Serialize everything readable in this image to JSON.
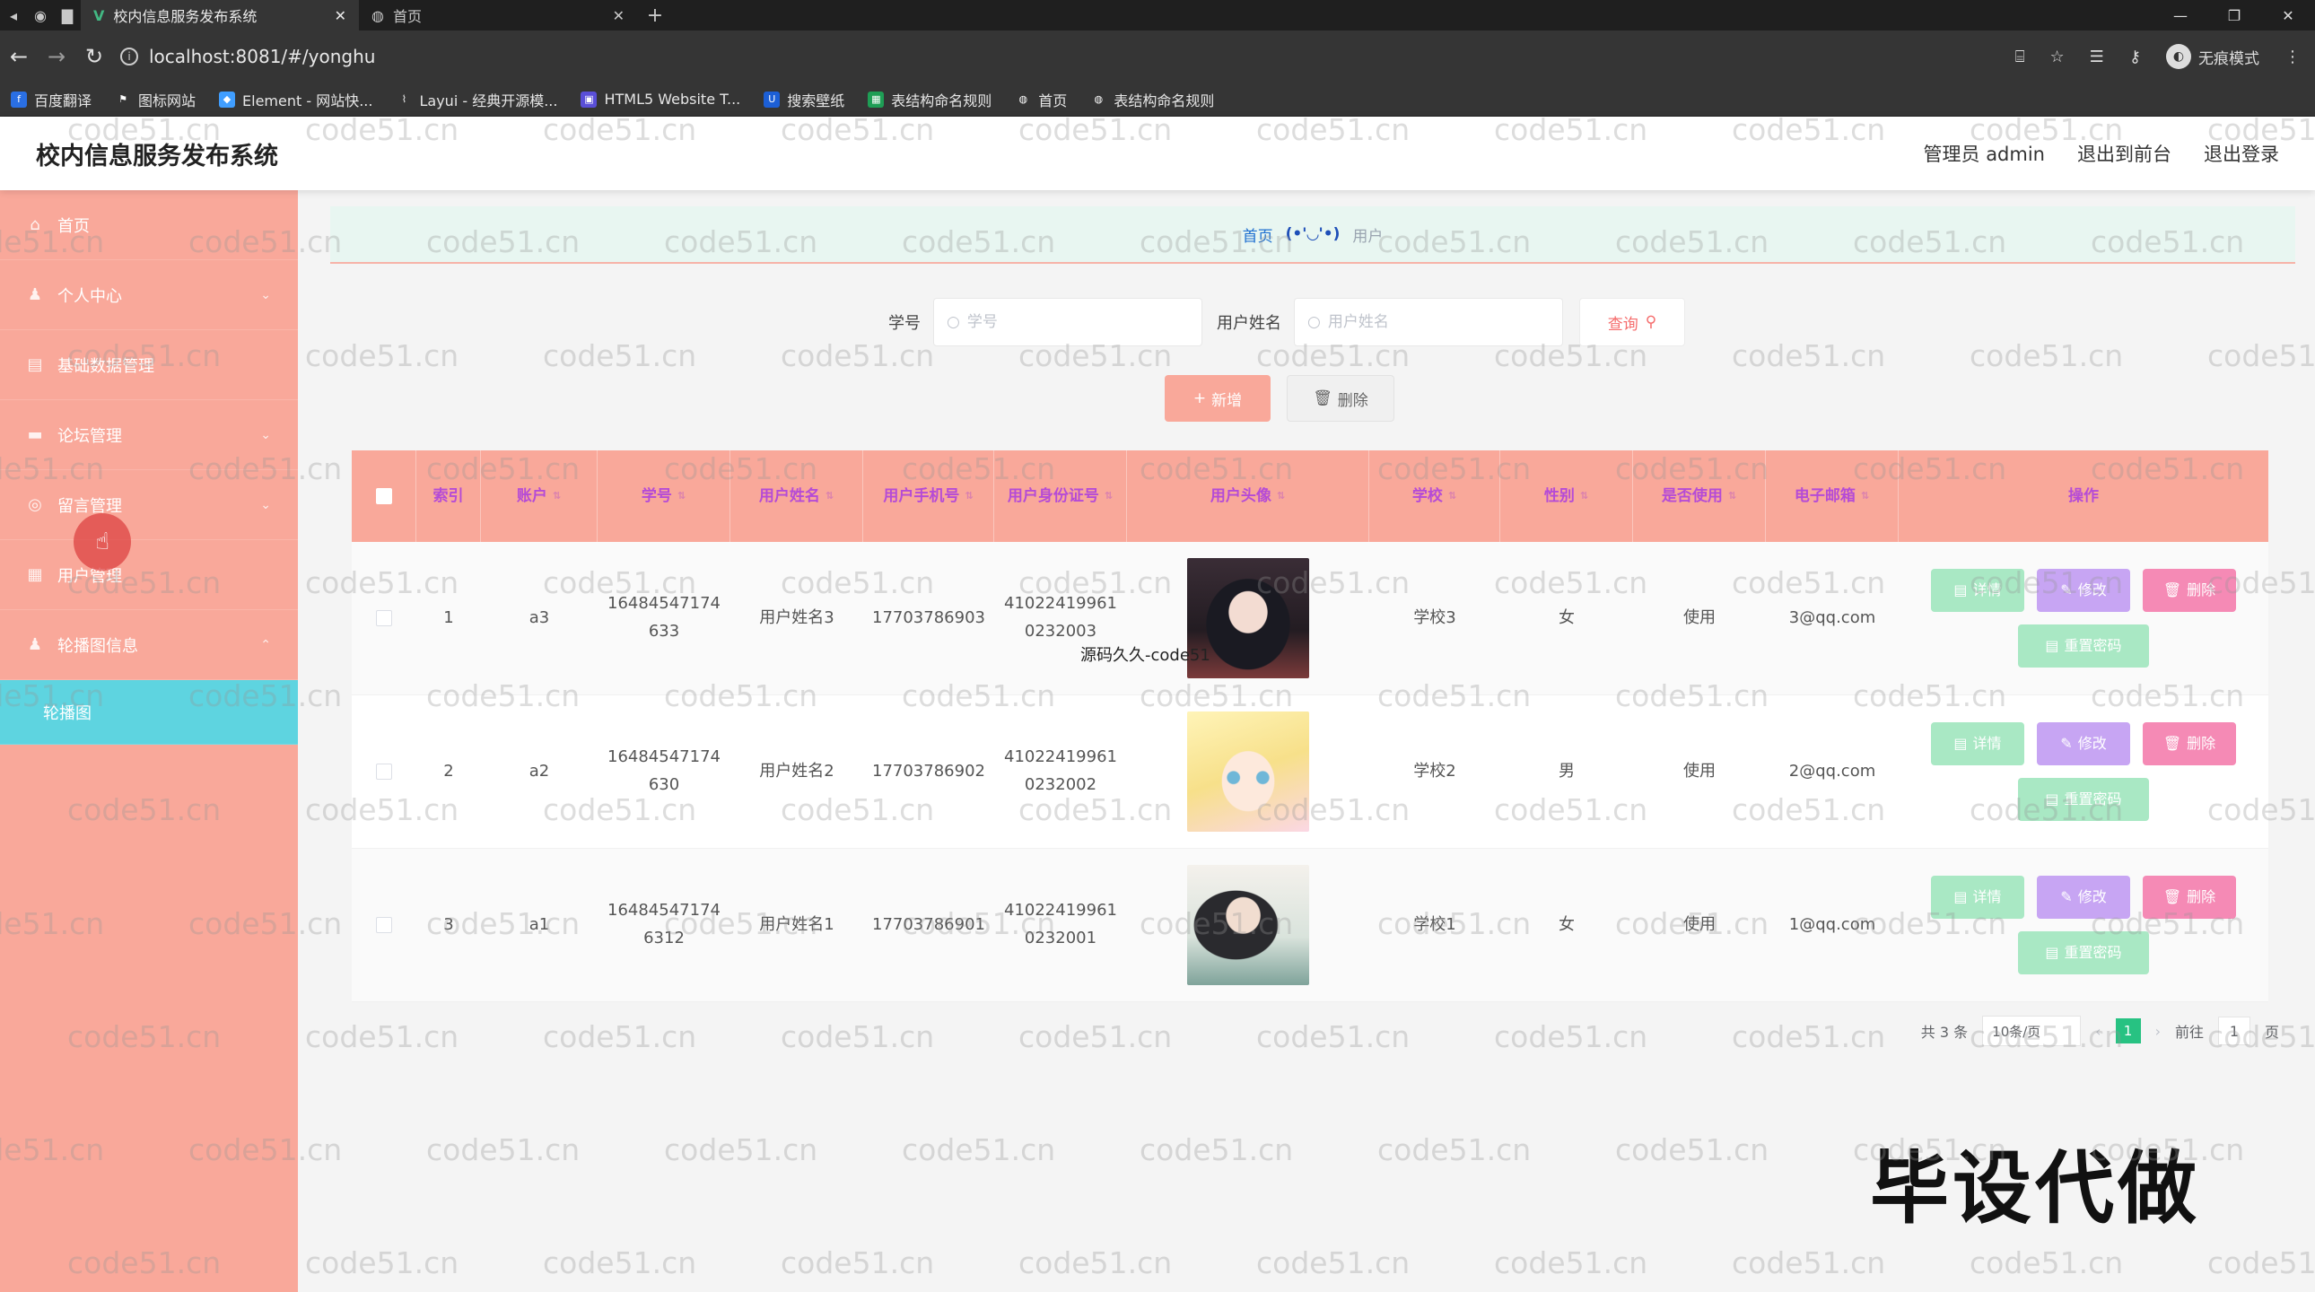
{
  "browser": {
    "tabs": [
      {
        "title": "校内信息服务发布系统",
        "active": true
      },
      {
        "title": "首页",
        "active": false
      }
    ],
    "url": "localhost:8081/#/yonghu",
    "profile_label": "无痕模式",
    "bookmarks": [
      {
        "label": "百度翻译",
        "icon": "baidu-translate-icon",
        "color": "#2a6fe3"
      },
      {
        "label": "图标网站",
        "icon": "flag-icon",
        "color": "#555555"
      },
      {
        "label": "Element - 网站快...",
        "icon": "element-icon",
        "color": "#409eff"
      },
      {
        "label": "Layui - 经典开源模...",
        "icon": "layui-icon",
        "color": "#555555"
      },
      {
        "label": "HTML5 Website T...",
        "icon": "html5-icon",
        "color": "#5a4fd8"
      },
      {
        "label": "搜索壁纸",
        "icon": "wallpaper-icon",
        "color": "#1c5fd6"
      },
      {
        "label": "表结构命名规则",
        "icon": "table-icon",
        "color": "#1e9e55"
      },
      {
        "label": "首页",
        "icon": "globe-icon",
        "color": "#555555"
      },
      {
        "label": "表结构命名规则",
        "icon": "globe-icon",
        "color": "#555555"
      }
    ]
  },
  "app": {
    "title": "校内信息服务发布系统",
    "header_links": [
      "管理员 admin",
      "退出到前台",
      "退出登录"
    ]
  },
  "sidebar": {
    "items": [
      {
        "label": "首页",
        "icon": "home-icon",
        "arrow": ""
      },
      {
        "label": "个人中心",
        "icon": "user-icon",
        "arrow": "⌄"
      },
      {
        "label": "基础数据管理",
        "icon": "grid-icon",
        "arrow": ""
      },
      {
        "label": "论坛管理",
        "icon": "forum-icon",
        "arrow": "⌄"
      },
      {
        "label": "留言管理",
        "icon": "message-icon",
        "arrow": "⌄"
      },
      {
        "label": "用户管理",
        "icon": "users-icon",
        "arrow": ""
      },
      {
        "label": "轮播图信息",
        "icon": "carousel-icon",
        "arrow": "⌃"
      }
    ],
    "active_sub": "轮播图"
  },
  "breadcrumb": {
    "home": "首页",
    "face": "(•'◡'•)",
    "current": "用户"
  },
  "search": {
    "field1_label": "学号",
    "field1_placeholder": "学号",
    "field2_label": "用户姓名",
    "field2_placeholder": "用户姓名",
    "query_label": "查询"
  },
  "actions": {
    "add_label": "新增",
    "delete_label": "删除"
  },
  "table": {
    "headers": [
      "索引",
      "账户",
      "学号",
      "用户姓名",
      "用户手机号",
      "用户身份证号",
      "用户头像",
      "学校",
      "性别",
      "是否使用",
      "电子邮箱",
      "操作"
    ],
    "rows": [
      {
        "index": "1",
        "account": "a3",
        "student_no": "16484547174633",
        "name": "用户姓名3",
        "phone": "17703786903",
        "id_card": "410224199610232003",
        "avatar": "dark-hair-girl",
        "school": "学校3",
        "gender": "女",
        "in_use": "使用",
        "email": "3@qq.com"
      },
      {
        "index": "2",
        "account": "a2",
        "student_no": "16484547174630",
        "name": "用户姓名2",
        "phone": "17703786902",
        "id_card": "410224199610232002",
        "avatar": "blonde-anime-girl",
        "school": "学校2",
        "gender": "男",
        "in_use": "使用",
        "email": "2@qq.com"
      },
      {
        "index": "3",
        "account": "a1",
        "student_no": "164845471746312",
        "name": "用户姓名1",
        "phone": "17703786901",
        "id_card": "410224199610232001",
        "avatar": "illustrated-girl",
        "school": "学校1",
        "gender": "女",
        "in_use": "使用",
        "email": "1@qq.com"
      }
    ],
    "row_actions": {
      "detail": "详情",
      "edit": "修改",
      "remove": "删除",
      "reset": "重置密码"
    }
  },
  "pagination": {
    "total": "共 3 条",
    "page_size": "10条/页",
    "current_page": "1",
    "goto_label": "前往",
    "goto_value": "1",
    "page_suffix": "页"
  },
  "overlays": {
    "source_caption": "源码久久-code51",
    "big_mark": "毕设代做",
    "watermark": "code51.cn"
  },
  "colors": {
    "sidebar": "#f9a89a",
    "sidebar_active": "#5ed4e0",
    "header_text": "#b54bd6",
    "detail": "#a9e8c4",
    "edit": "#c7a5f3",
    "remove": "#f58ab5",
    "accent_blue": "#1e6fd0"
  }
}
